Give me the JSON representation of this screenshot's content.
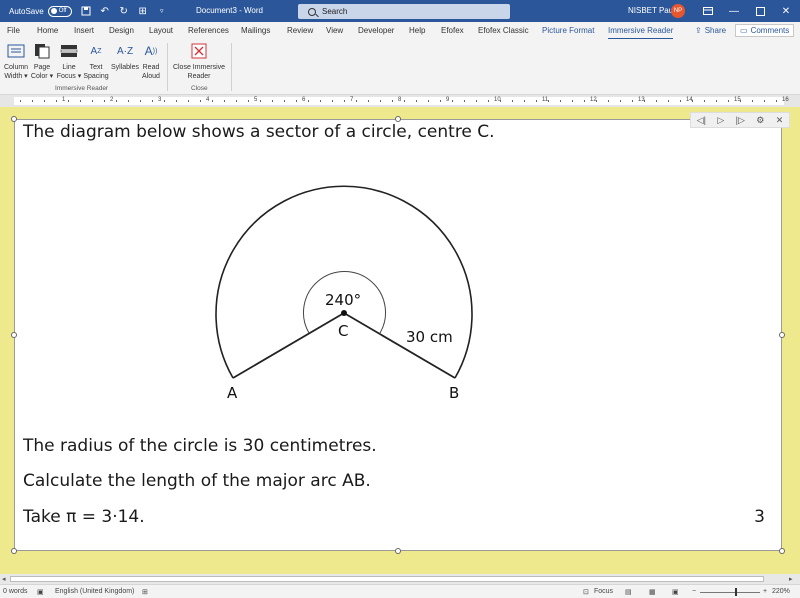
{
  "titlebar": {
    "autosave_label": "AutoSave",
    "autosave_state": "Off",
    "doc_title": "Document3  -  Word",
    "search_placeholder": "Search",
    "user_name": "NISBET Paul",
    "user_initials": "NP",
    "accent": "#2b579a",
    "avatar_color": "#e7562c"
  },
  "tabs": {
    "file": "File",
    "home": "Home",
    "insert": "Insert",
    "design": "Design",
    "layout": "Layout",
    "references": "References",
    "mailings": "Mailings",
    "review": "Review",
    "view": "View",
    "developer": "Developer",
    "help": "Help",
    "efofex": "Efofex",
    "efofex_classic": "Efofex Classic",
    "picture_format": "Picture Format",
    "immersive_reader": "Immersive Reader",
    "share": "Share",
    "comments": "Comments"
  },
  "ribbon": {
    "column_width": [
      "Column",
      "Width ▾"
    ],
    "page_color": [
      "Page",
      "Color ▾"
    ],
    "line_focus": [
      "Line",
      "Focus ▾"
    ],
    "text_spacing": [
      "Text",
      "Spacing"
    ],
    "syllables": "Syllables",
    "read_aloud": [
      "Read",
      "Aloud"
    ],
    "close_immersive": [
      "Close Immersive",
      "Reader"
    ],
    "group_immersive": "Immersive Reader",
    "group_close": "Close"
  },
  "ruler": {
    "numbers": [
      "1",
      "2",
      "3",
      "4",
      "5",
      "6",
      "7",
      "8",
      "9",
      "10",
      "11",
      "12",
      "13",
      "14",
      "15",
      "16"
    ]
  },
  "document": {
    "line1": "The diagram below shows a sector of a circle, centre C.",
    "line2": "The radius of the circle is 30 centimetres.",
    "line3": "Calculate the length of the major arc AB.",
    "line4_prefix": "Take π = 3·14.",
    "marks": "3",
    "diagram": {
      "angle_label": "240°",
      "centre_label": "C",
      "radius_label": "30 cm",
      "point_a": "A",
      "point_b": "B"
    }
  },
  "statusbar": {
    "words": "0 words",
    "language": "English (United Kingdom)",
    "focus": "Focus",
    "zoom": "220%"
  }
}
